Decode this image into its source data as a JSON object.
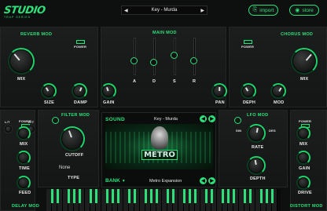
{
  "header": {
    "logo": "STUDIO",
    "logo_sub": "TRAP SERIES",
    "preset": "Key - Murda",
    "import_label": "import",
    "store_label": "store"
  },
  "sections": {
    "reverb": "REVERB MOD",
    "main": "MAIN MOD",
    "chorus": "CHORUS MOD",
    "filter": "FILTER MOD",
    "lfo": "LFO MOD",
    "delay": "DELAY MOD",
    "distort": "DISTORT MOD",
    "sound": "SOUND"
  },
  "labels": {
    "power": "POWER",
    "mix": "MIX",
    "size": "SIZE",
    "damp": "DAMP",
    "gain": "GAIN",
    "pan": "PAN",
    "deph": "DEPH",
    "mod": "MOD",
    "cutoff": "CUTOFF",
    "type": "TYPE",
    "filter_type_value": "None",
    "time": "TIME",
    "feed": "FEED",
    "rate": "RATE",
    "depth": "DEPTH",
    "drive": "DRIVE",
    "lt": "L/T",
    "rt": "R-T",
    "sin": "SIN",
    "des": "DES",
    "bank": "BANK"
  },
  "adsr": [
    {
      "label": "A",
      "level": 0.35
    },
    {
      "label": "D",
      "level": 0.3
    },
    {
      "label": "S",
      "level": 0.55
    },
    {
      "label": "R",
      "level": 0.35
    }
  ],
  "sound": {
    "preset_name": "Key - Murda",
    "bank_name": "Metro Expansion",
    "art_text": "METRO"
  },
  "colors": {
    "accent": "#2ee07a",
    "background": "#0e0f0f"
  }
}
